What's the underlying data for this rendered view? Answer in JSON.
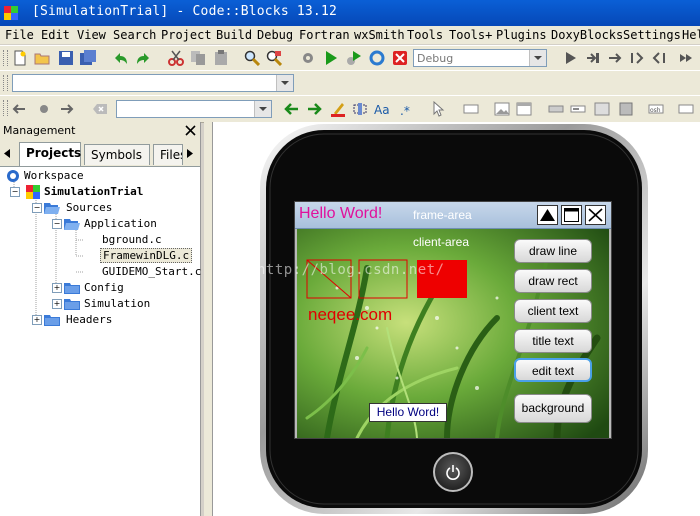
{
  "window": {
    "title": "[SimulationTrial] - Code::Blocks 13.12"
  },
  "menu": [
    "File",
    "Edit",
    "View",
    "Search",
    "Project",
    "Build",
    "Debug",
    "Fortran",
    "wxSmith",
    "Tools",
    "Tools+",
    "Plugins",
    "DoxyBlocks",
    "Settings",
    "Help"
  ],
  "toolbar": {
    "build_target": "Debug"
  },
  "management": {
    "title": "Management",
    "tabs": [
      "Projects",
      "Symbols",
      "Files"
    ],
    "tree": {
      "workspace": "Workspace",
      "project": "SimulationTrial",
      "sources": "Sources",
      "application": "Application",
      "files": [
        "bground.c",
        "FramewinDLG.c",
        "GUIDEMO_Start.c"
      ],
      "config": "Config",
      "simulation": "Simulation",
      "headers": "Headers"
    }
  },
  "watermark": "http://blog.csdn.net/",
  "device": {
    "frame_title": "Hello Word!",
    "frame_area_label": "frame-area",
    "client_area_label": "client-area",
    "brand_text": "neqee.com",
    "hello_box": "Hello Word!",
    "buttons": [
      "draw line",
      "draw rect",
      "client text",
      "title text",
      "edit text",
      "background"
    ],
    "power_icon": "power-icon"
  },
  "colors": {
    "title_bg": "#0652c5",
    "frame_title_text": "#e0109c",
    "red_square": "#ee0000",
    "brand_text": "#e00000"
  }
}
